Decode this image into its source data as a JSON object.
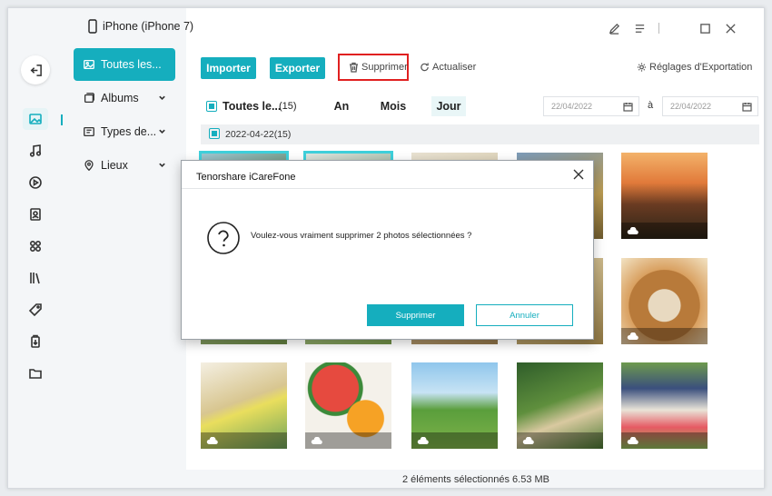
{
  "window": {
    "device_name": "iPhone (iPhone 7)"
  },
  "icons": {
    "device": "phone-icon",
    "pen": "pen-icon",
    "menu": "menu-icon",
    "maximize": "maximize-icon",
    "close": "close-icon",
    "exit": "exit-icon",
    "rail": [
      "photo-icon",
      "music-icon",
      "video-icon",
      "contacts-icon",
      "apps-icon",
      "books-icon",
      "tag-icon",
      "backup-icon",
      "folder-icon"
    ]
  },
  "colors": {
    "accent": "#15aebe",
    "highlight_box": "#e02020"
  },
  "nav": {
    "items": [
      {
        "label": "Toutes les...",
        "icon": "image-icon",
        "active": true
      },
      {
        "label": "Albums",
        "icon": "album-icon"
      },
      {
        "label": "Types de...",
        "icon": "type-icon"
      },
      {
        "label": "Lieux",
        "icon": "location-icon"
      }
    ]
  },
  "toolbar": {
    "import_label": "Importer",
    "export_label": "Exporter",
    "delete_label": "Supprimer",
    "refresh_label": "Actualiser",
    "export_settings_label": "Réglages d'Exportation"
  },
  "filter": {
    "all_label": "Toutes le...",
    "all_count": "(15)",
    "segments": [
      "An",
      "Mois",
      "Jour"
    ],
    "active_segment": "Jour",
    "date_from": "22/04/2022",
    "date_sep": "à",
    "date_to": "22/04/2022"
  },
  "group": {
    "date": "2022-04-22",
    "count": "(15)"
  },
  "status": {
    "text": "2 éléments sélectionnés 6.53 MB"
  },
  "dialog": {
    "title": "Tenorshare iCareFone",
    "message": "Voulez-vous vraiment supprimer 2 photos sélectionnées ?",
    "confirm_label": "Supprimer",
    "cancel_label": "Annuler"
  }
}
